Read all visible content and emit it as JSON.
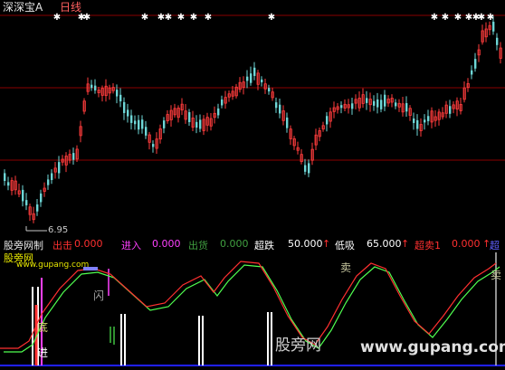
{
  "header": {
    "title": "深深宝A",
    "period": "日线"
  },
  "price_chart": {
    "low_label": "6.95",
    "colors": {
      "up": "#ff3c3c",
      "down": "#6ed6d6",
      "grid": "#8a0000"
    }
  },
  "indicator": {
    "name": "股旁网制",
    "params": [
      {
        "label": "出击",
        "value": "0.000",
        "color": "#ff3030"
      },
      {
        "label": "进入",
        "value": "0.000",
        "color": "#ff40ff"
      },
      {
        "label": "出货",
        "value": "0.000",
        "color": "#40a040"
      },
      {
        "label": "超跌",
        "value": "50.000",
        "color": "#ffffff"
      },
      {
        "label": "低吸",
        "value": "65.000",
        "color": "#ffffff"
      },
      {
        "label": "超卖1",
        "value": "0.000",
        "color": "#ff3030"
      }
    ],
    "tail_label": "超",
    "signals": {
      "sell": "卖",
      "flash": "闪",
      "bottom": "底",
      "entry": "进",
      "sell_right": "卖"
    },
    "colors": {
      "line_fast": "#ff3030",
      "line_slow": "#50ff50",
      "baseline": "#2020ff"
    }
  },
  "watermark": {
    "brand": "股旁网",
    "url": "www.gupang.com",
    "big_text": "股旁网",
    "big_url": "www.gupang.com"
  }
}
